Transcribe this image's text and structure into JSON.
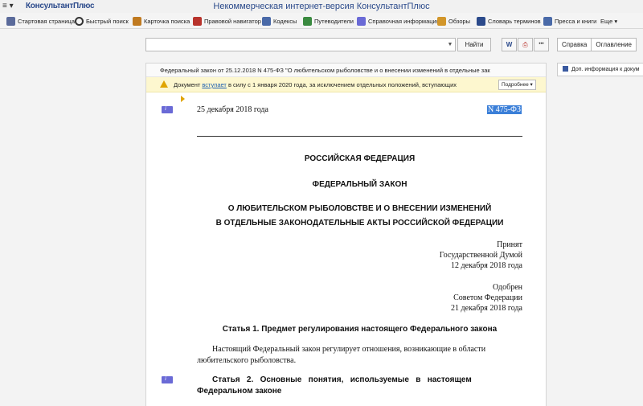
{
  "app": {
    "menu_icon": "≡ ▾",
    "logo": "КонсультантПлюс",
    "window_title": "Некоммерческая интернет-версия КонсультантПлюс"
  },
  "toolbar": {
    "items": [
      {
        "label": "Стартовая страница",
        "icon": "home-icon",
        "color": "#5a6a9a"
      },
      {
        "label": "Быстрый поиск",
        "icon": "search-icon",
        "color": "#333333"
      },
      {
        "label": "Карточка поиска",
        "icon": "search-card-icon",
        "color": "#c07a20"
      },
      {
        "label": "Правовой навигатор",
        "icon": "navigator-icon",
        "color": "#b8332c"
      },
      {
        "label": "Кодексы",
        "icon": "codes-icon",
        "color": "#4a6aa8"
      },
      {
        "label": "Путеводители",
        "icon": "guides-icon",
        "color": "#3a8a40"
      },
      {
        "label": "Справочная информация",
        "icon": "reference-icon",
        "color": "#6a6ad6"
      },
      {
        "label": "Обзоры",
        "icon": "reviews-icon",
        "color": "#d2962a"
      },
      {
        "label": "Словарь терминов",
        "icon": "dictionary-icon",
        "color": "#2b4a8b"
      },
      {
        "label": "Пресса и книги",
        "icon": "press-icon",
        "color": "#4a6aa8"
      },
      {
        "label": "Еще ▾",
        "icon": "",
        "color": ""
      }
    ]
  },
  "search": {
    "value": "",
    "find_label": "Найти",
    "word_label": "W",
    "print_label": "⎙",
    "more_label": "•••"
  },
  "right_tabs": [
    "Справка",
    "Оглавление"
  ],
  "right_panel": {
    "item": "Доп. информация к докум"
  },
  "document": {
    "header": "Федеральный закон от 25.12.2018 N 475-ФЗ \"О любительском рыболовстве и о внесении изменений в отдельные зак",
    "warning": {
      "pre": "Документ ",
      "link": "вступает",
      "post": " в силу с 1 января 2020 года, за исключением отдельных положений, вступающих",
      "more": "Подробнее ▾"
    },
    "date": "25 декабря 2018 года",
    "number": "N 475-ФЗ",
    "heading1": "РОССИЙСКАЯ ФЕДЕРАЦИЯ",
    "heading2": "ФЕДЕРАЛЬНЫЙ ЗАКОН",
    "title_line1": "О ЛЮБИТЕЛЬСКОМ РЫБОЛОВСТВЕ И О ВНЕСЕНИИ ИЗМЕНЕНИЙ",
    "title_line2": "В ОТДЕЛЬНЫЕ ЗАКОНОДАТЕЛЬНЫЕ АКТЫ РОССИЙСКОЙ ФЕДЕРАЦИИ",
    "adopted": [
      "Принят",
      "Государственной Думой",
      "12 декабря 2018 года"
    ],
    "approved": [
      "Одобрен",
      "Советом Федерации",
      "21 декабря 2018 года"
    ],
    "article1_title": "Статья 1. Предмет регулирования настоящего Федерального закона",
    "article1_text_line1": "Настоящий Федеральный закон регулирует отношения, возникающие в области",
    "article1_text_line2": "любительского рыболовства.",
    "article2_title_line1": "Статья   2.   Основные   понятия,   используемые   в   настоящем",
    "article2_title_line2": "Федеральном законе"
  }
}
